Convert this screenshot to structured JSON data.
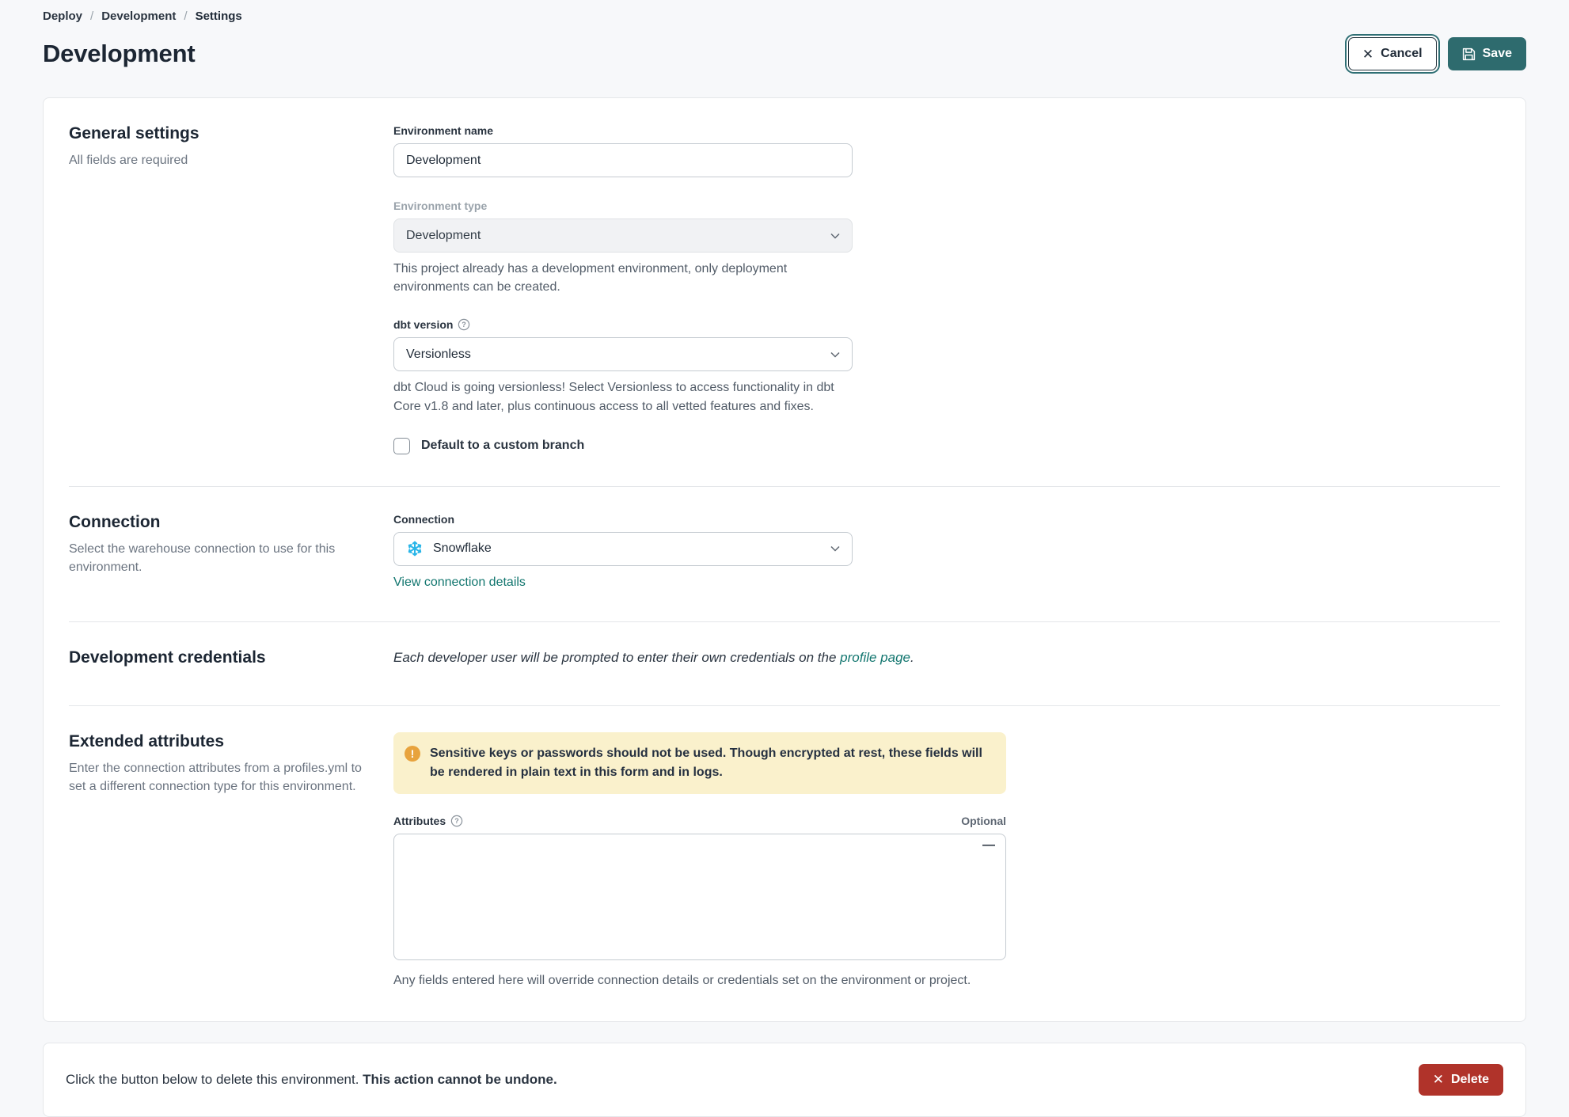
{
  "breadcrumb": {
    "items": [
      "Deploy",
      "Development",
      "Settings"
    ],
    "separator": "/"
  },
  "header": {
    "title": "Development",
    "cancel_label": "Cancel",
    "save_label": "Save"
  },
  "general": {
    "heading": "General settings",
    "subheading": "All fields are required",
    "env_name": {
      "label": "Environment name",
      "value": "Development"
    },
    "env_type": {
      "label": "Environment type",
      "value": "Development",
      "help": "This project already has a development environment, only deployment environments can be created."
    },
    "dbt_version": {
      "label": "dbt version",
      "value": "Versionless",
      "help": "dbt Cloud is going versionless! Select Versionless to access functionality in dbt Core v1.8 and later, plus continuous access to all vetted features and fixes."
    },
    "custom_branch": {
      "label": "Default to a custom branch",
      "checked": false
    }
  },
  "connection": {
    "heading": "Connection",
    "subheading": "Select the warehouse connection to use for this environment.",
    "field_label": "Connection",
    "value": "Snowflake",
    "link": "View connection details"
  },
  "credentials": {
    "heading": "Development credentials",
    "text_before": "Each developer user will be prompted to enter their own credentials on the ",
    "link": "profile page",
    "text_after": "."
  },
  "extended": {
    "heading": "Extended attributes",
    "subheading": "Enter the connection attributes from a profiles.yml to set a different connection type for this environment.",
    "warning": "Sensitive keys or passwords should not be used. Though encrypted at rest, these fields will be rendered in plain text in this form and in logs.",
    "attributes_label": "Attributes",
    "optional_label": "Optional",
    "attributes_value": "",
    "help": "Any fields entered here will override connection details or credentials set on the environment or project."
  },
  "danger": {
    "text_normal": "Click the button below to delete this environment. ",
    "text_bold": "This action cannot be undone.",
    "delete_label": "Delete"
  },
  "icons": {
    "cancel_x": "✕",
    "delete_x": "✕",
    "collapse_dash": "—",
    "help_q": "?",
    "warning_mark": "!"
  },
  "colors": {
    "accent_teal": "#2e6b6e",
    "link_teal": "#12766f",
    "danger_red": "#b0332a",
    "warning_bg": "#faf1cc",
    "warning_icon": "#e8a33d",
    "snowflake_blue": "#29b5e8",
    "page_bg": "#f7f8fa"
  }
}
